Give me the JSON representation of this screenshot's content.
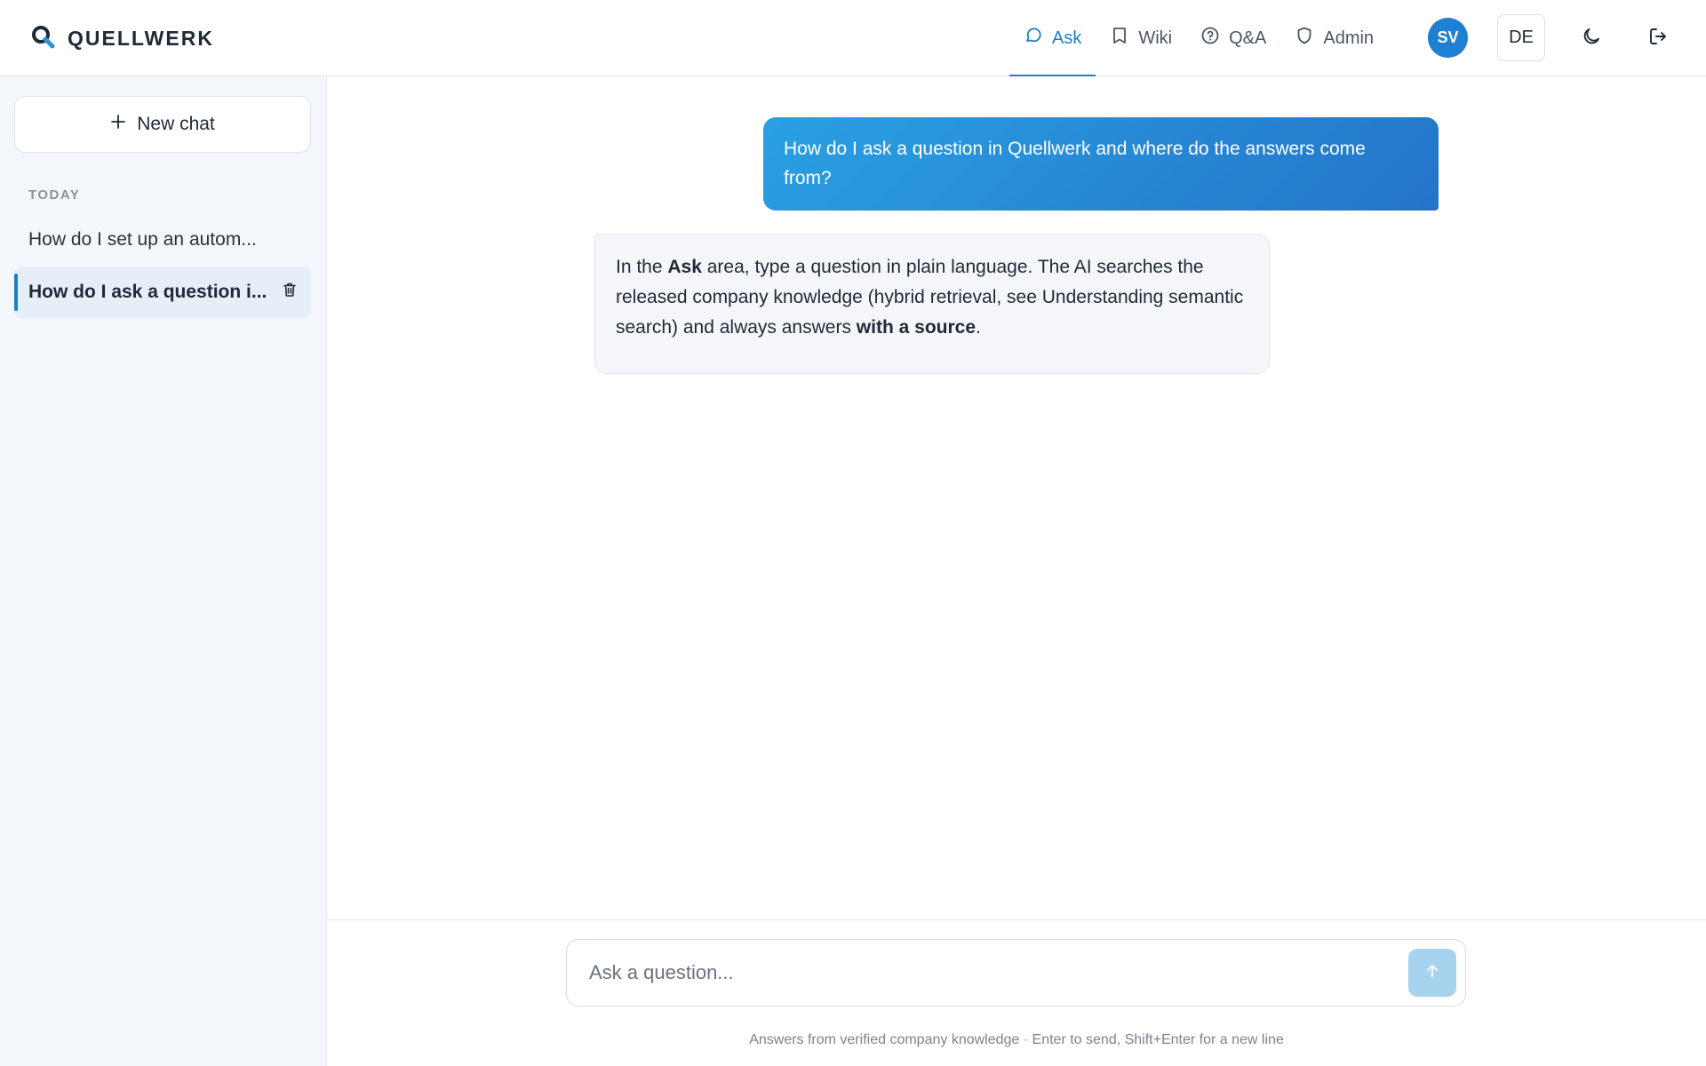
{
  "app": {
    "brand": "QUELLWERK"
  },
  "nav": {
    "items": [
      {
        "label": "Ask",
        "icon": "chat-bubble-icon",
        "active": true
      },
      {
        "label": "Wiki",
        "icon": "book-icon",
        "active": false
      },
      {
        "label": "Q&A",
        "icon": "help-circle-icon",
        "active": false
      },
      {
        "label": "Admin",
        "icon": "shield-icon",
        "active": false
      }
    ],
    "avatar_initials": "SV",
    "language": "DE"
  },
  "sidebar": {
    "new_chat_label": "New chat",
    "section_label": "TODAY",
    "chats": [
      {
        "label": "How do I set up an autom...",
        "active": false
      },
      {
        "label": "How do I ask a question i...",
        "active": true
      }
    ]
  },
  "conversation": {
    "user_message": "How do I ask a question in Quellwerk and where do the answers come from?",
    "bot_message": {
      "t1": "In the ",
      "b1": "Ask",
      "t2": " area, type a question in plain language. The AI searches the released company knowledge (hybrid retrieval, see Understanding semantic search) and always answers ",
      "b2": "with a source",
      "t3": "."
    }
  },
  "composer": {
    "placeholder": "Ask a question...",
    "hint": "Answers from verified company knowledge · Enter to send, Shift+Enter for a new line"
  },
  "colors": {
    "accent": "#1d7fc4",
    "user_bubble_start": "#2aa0e3",
    "user_bubble_end": "#2474c9",
    "send_button_disabled": "#a8d3ef",
    "sidebar_bg": "#f3f6fa"
  }
}
